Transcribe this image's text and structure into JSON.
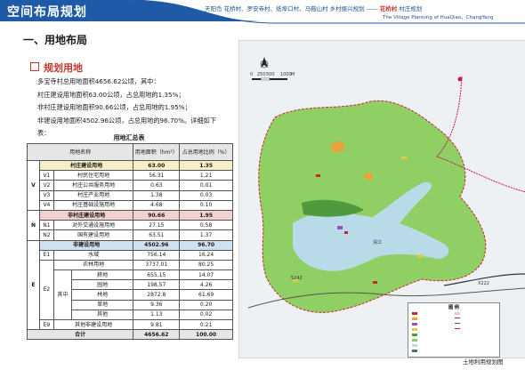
{
  "header": {
    "title": "空间布局规划",
    "subtitle_cn": "天阳岙 花桥村、罗安寺村、纸埠口村、马鞍山村 乡村振兴规划 ——",
    "brand": "花桥村",
    "brand_suffix": "村庄规划",
    "subtitle_en": "The Village Planning of HuaQiao，ChangYang"
  },
  "section_title": "一、用地布局",
  "sub_title": "规划用地",
  "paragraph": [
    "多宝寺村总用地面积4656.62公顷，其中：",
    "村庄建设用地面积63.00公顷，占总用地的1.35%；",
    "非村庄建设用地面积90.66公顷，占总用地的1.95%；",
    "非建设用地面积4502.96公顷，占总用地的96.70%。详细如下",
    "表："
  ],
  "table": {
    "caption": "用地汇总表",
    "headers": {
      "name": "用地名称",
      "area": "用地面积（hm²）",
      "ratio": "占总用地比例（%）"
    },
    "rows": [
      {
        "group": "V",
        "code": "",
        "name": "村庄建设用地",
        "area": "63.00",
        "ratio": "1.35"
      },
      {
        "code": "V1",
        "name": "村民住宅用地",
        "area": "56.31",
        "ratio": "1.21"
      },
      {
        "code": "V2",
        "name": "村庄公共服务用地",
        "area": "0.63",
        "ratio": "0.01"
      },
      {
        "code": "V3",
        "name": "村庄产业用地",
        "area": "1.38",
        "ratio": "0.03"
      },
      {
        "code": "V4",
        "name": "村庄基础设施用地",
        "area": "4.68",
        "ratio": "0.10"
      },
      {
        "group": "N",
        "code": "",
        "name": "非村庄建设用地",
        "area": "90.66",
        "ratio": "1.95"
      },
      {
        "code": "N1",
        "name": "对外交通设施用地",
        "area": "27.15",
        "ratio": "0.58"
      },
      {
        "code": "N2",
        "name": "国有建设用地",
        "area": "63.51",
        "ratio": "1.37"
      },
      {
        "group": "E",
        "code": "",
        "name": "非建设用地",
        "area": "4502.96",
        "ratio": "96.70"
      },
      {
        "code": "E1",
        "name": "水域",
        "area": "756.14",
        "ratio": "16.24"
      },
      {
        "code": "",
        "name": "农林用地",
        "area": "3737.01",
        "ratio": "80.25"
      },
      {
        "code": "",
        "sub": "其中",
        "name": "耕地",
        "area": "655.15",
        "ratio": "14.07"
      },
      {
        "code": "",
        "name": "园地",
        "area": "198.57",
        "ratio": "4.26"
      },
      {
        "code": "",
        "name": "林地",
        "area": "2872.8",
        "ratio": "61.69"
      },
      {
        "code": "",
        "name": "草地",
        "area": "9.36",
        "ratio": "0.20"
      },
      {
        "code": "",
        "name": "其他",
        "area": "1.13",
        "ratio": "0.02"
      },
      {
        "code": "E9",
        "name": "其他非建设用地",
        "area": "9.81",
        "ratio": "0.21"
      }
    ],
    "e2_code": "E2",
    "total": {
      "name": "合计",
      "area": "4656.62",
      "ratio": "100.00"
    }
  },
  "map": {
    "scale_labels": [
      "0",
      "250",
      "500",
      "1000"
    ],
    "scale_unit": "M",
    "road_labels": [
      "S242",
      "X222",
      "清江"
    ],
    "legend_title": "图 例",
    "caption": "土地利用规划图"
  },
  "colors": {
    "header_blue": "#1f5aa6",
    "accent_red": "#c0392b",
    "forest_green": "#8fcf63",
    "water_blue": "#b9dbe8",
    "outside_gray": "#f2f4f6"
  }
}
